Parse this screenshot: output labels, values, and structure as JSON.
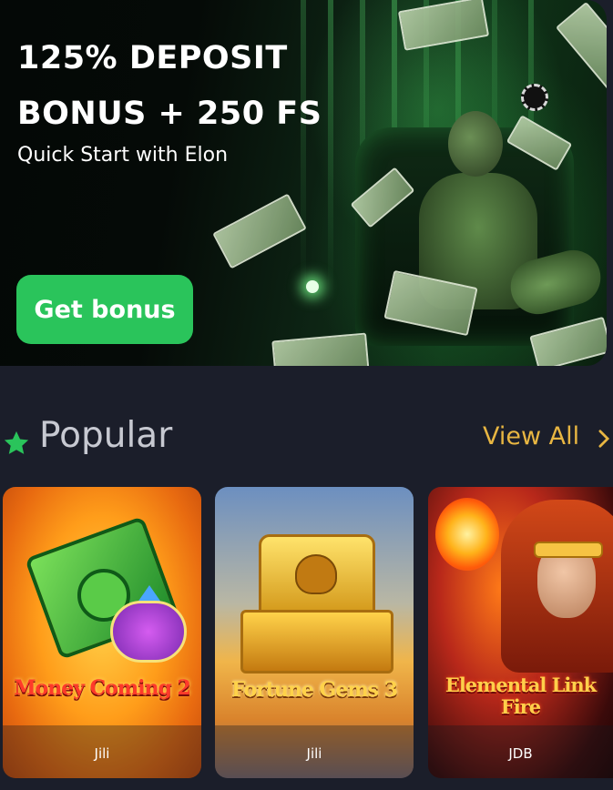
{
  "banner": {
    "title": "125% DEPOSIT BONUS + 250 FS",
    "subtitle": "Quick Start with Elon",
    "button_label": "Get bonus"
  },
  "section": {
    "title": "Popular",
    "view_all_label": "View All"
  },
  "games": [
    {
      "title": "Money Coming 2",
      "provider": "Jili"
    },
    {
      "title": "Fortune Gems 3",
      "provider": "Jili"
    },
    {
      "title": "Elemental Link Fire",
      "provider": "JDB"
    }
  ],
  "colors": {
    "background": "#1b1e2a",
    "button_green": "#2ac45b",
    "accent_gold": "#e8b642",
    "star_green": "#2ac45b"
  },
  "icons": {
    "section": "star-icon",
    "view_all": "chevron-right-icon"
  }
}
